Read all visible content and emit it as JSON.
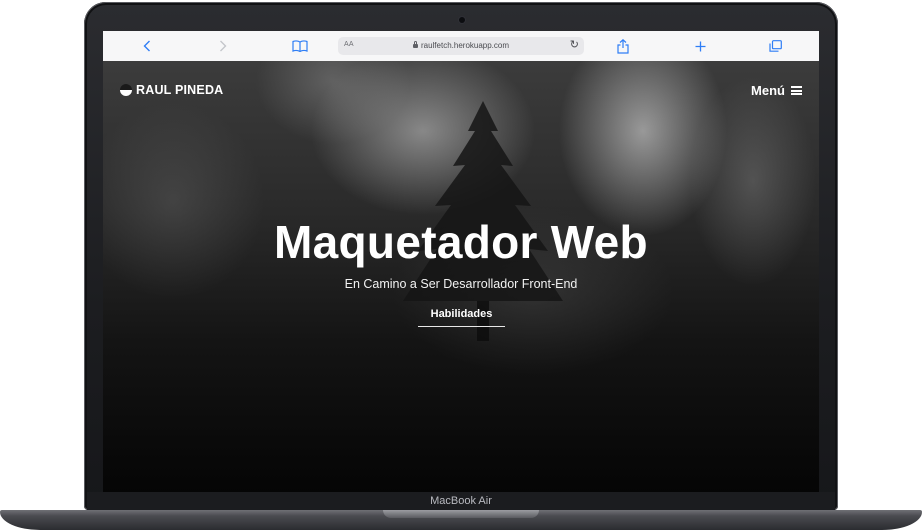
{
  "browser": {
    "url_prefix": "AA",
    "url": "raulfetch.herokuapp.com"
  },
  "site": {
    "brand": "RAUL PINEDA",
    "menu_label": "Menú",
    "hero_title": "Maquetador Web",
    "hero_subtitle": "En Camino a Ser Desarrollador Front-End",
    "cta_label": "Habilidades"
  },
  "device": {
    "model": "MacBook Air"
  },
  "colors": {
    "safari_accent": "#2f7ef6",
    "hero_text": "#ffffff",
    "laptop_body": "#2b2c30"
  },
  "icons": [
    "back-icon",
    "forward-icon",
    "bookmarks-icon",
    "lock-icon",
    "reload-icon",
    "share-icon",
    "new-tab-icon",
    "tabs-icon",
    "menu-icon"
  ]
}
